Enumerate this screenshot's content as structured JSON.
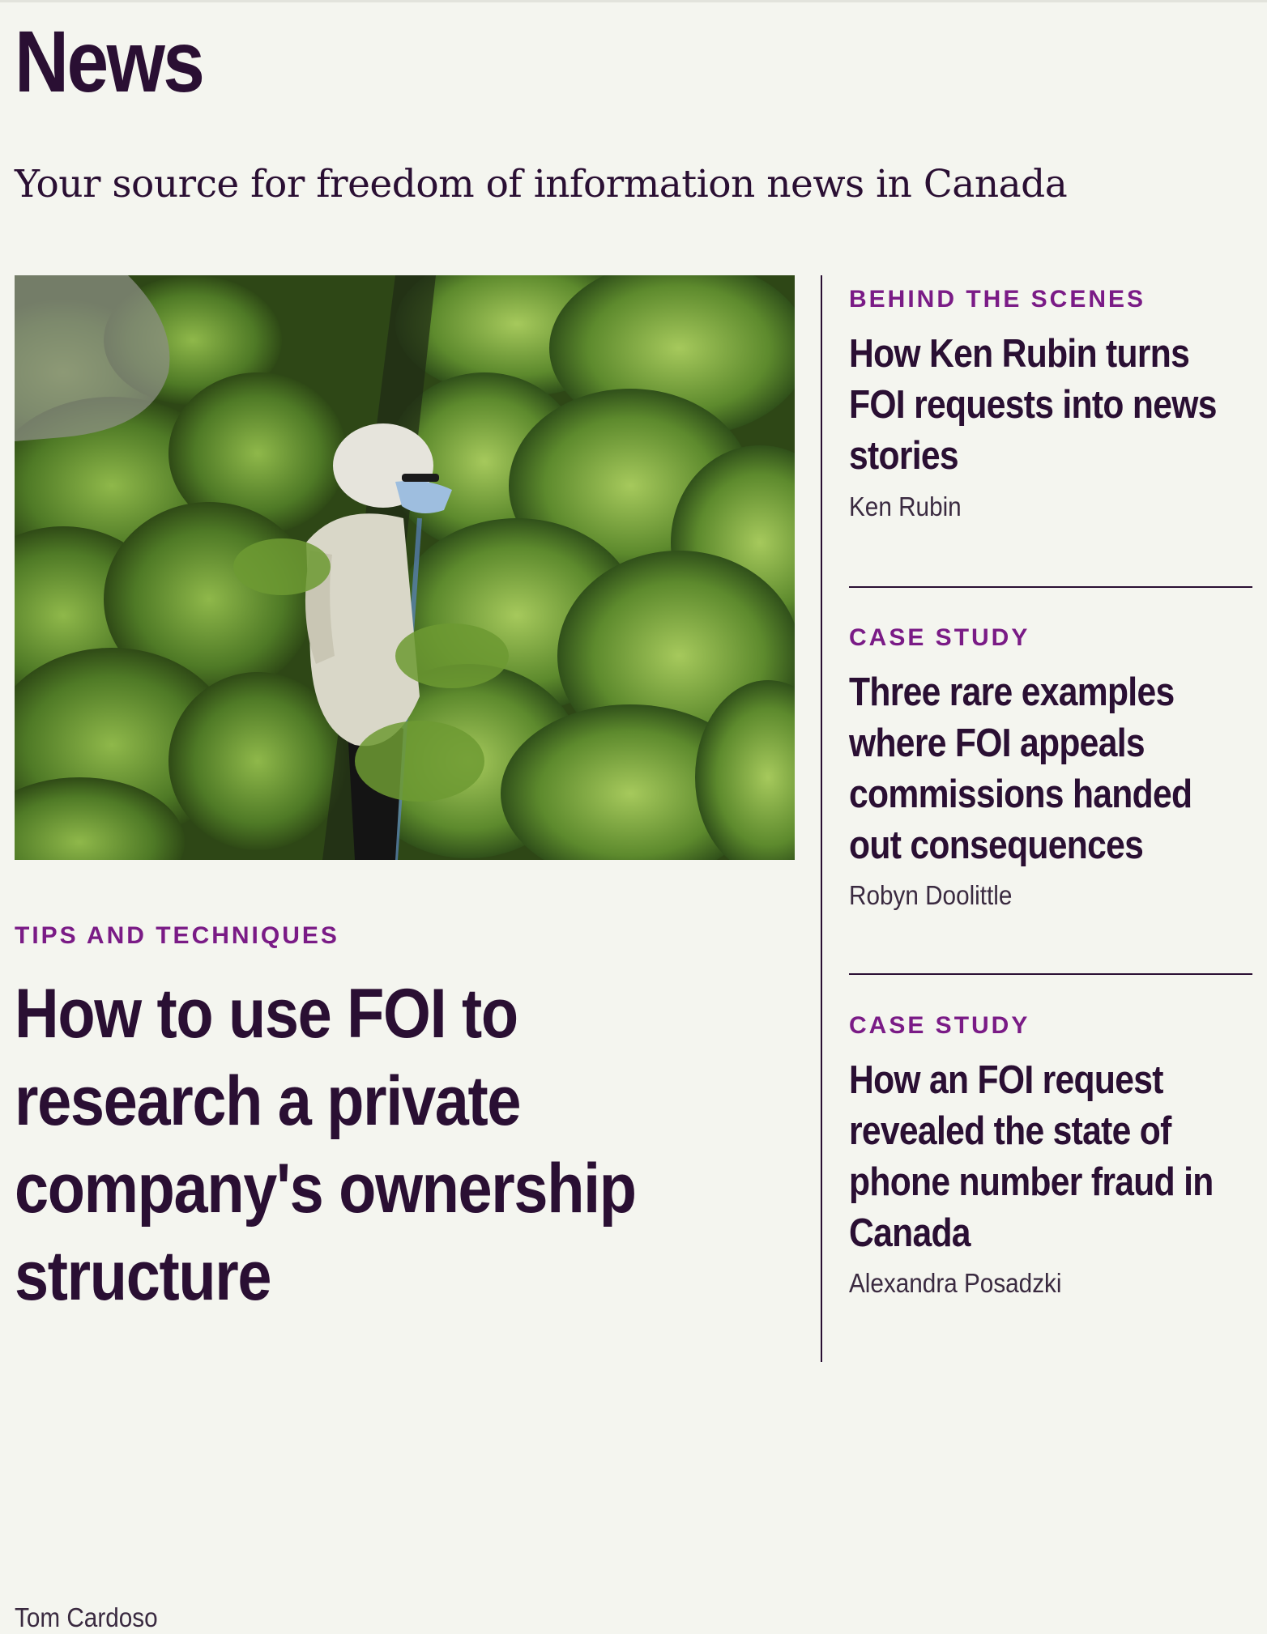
{
  "page": {
    "title": "News",
    "subtitle": "Your source for freedom of information news in Canada"
  },
  "featured": {
    "category": "TIPS AND TECHNIQUES",
    "headline": "How to use FOI to research a private company's ownership structure",
    "author": "Tom Cardoso",
    "image_icon": "photo-worker-in-cannabis-greenhouse"
  },
  "sidebar": {
    "articles": [
      {
        "category": "BEHIND THE SCENES",
        "headline": "How Ken Rubin turns FOI requests into news stories",
        "author": "Ken Rubin"
      },
      {
        "category": "CASE STUDY",
        "headline": "Three rare examples where FOI appeals commissions handed out consequences",
        "author": "Robyn Doolittle"
      },
      {
        "category": "CASE STUDY",
        "headline": "How an FOI request revealed the state of phone number fraud in Canada",
        "author": "Alexandra Posadzki"
      }
    ]
  },
  "colors": {
    "background": "#f4f5ef",
    "text": "#2a0f33",
    "kicker": "#7a1b86"
  }
}
